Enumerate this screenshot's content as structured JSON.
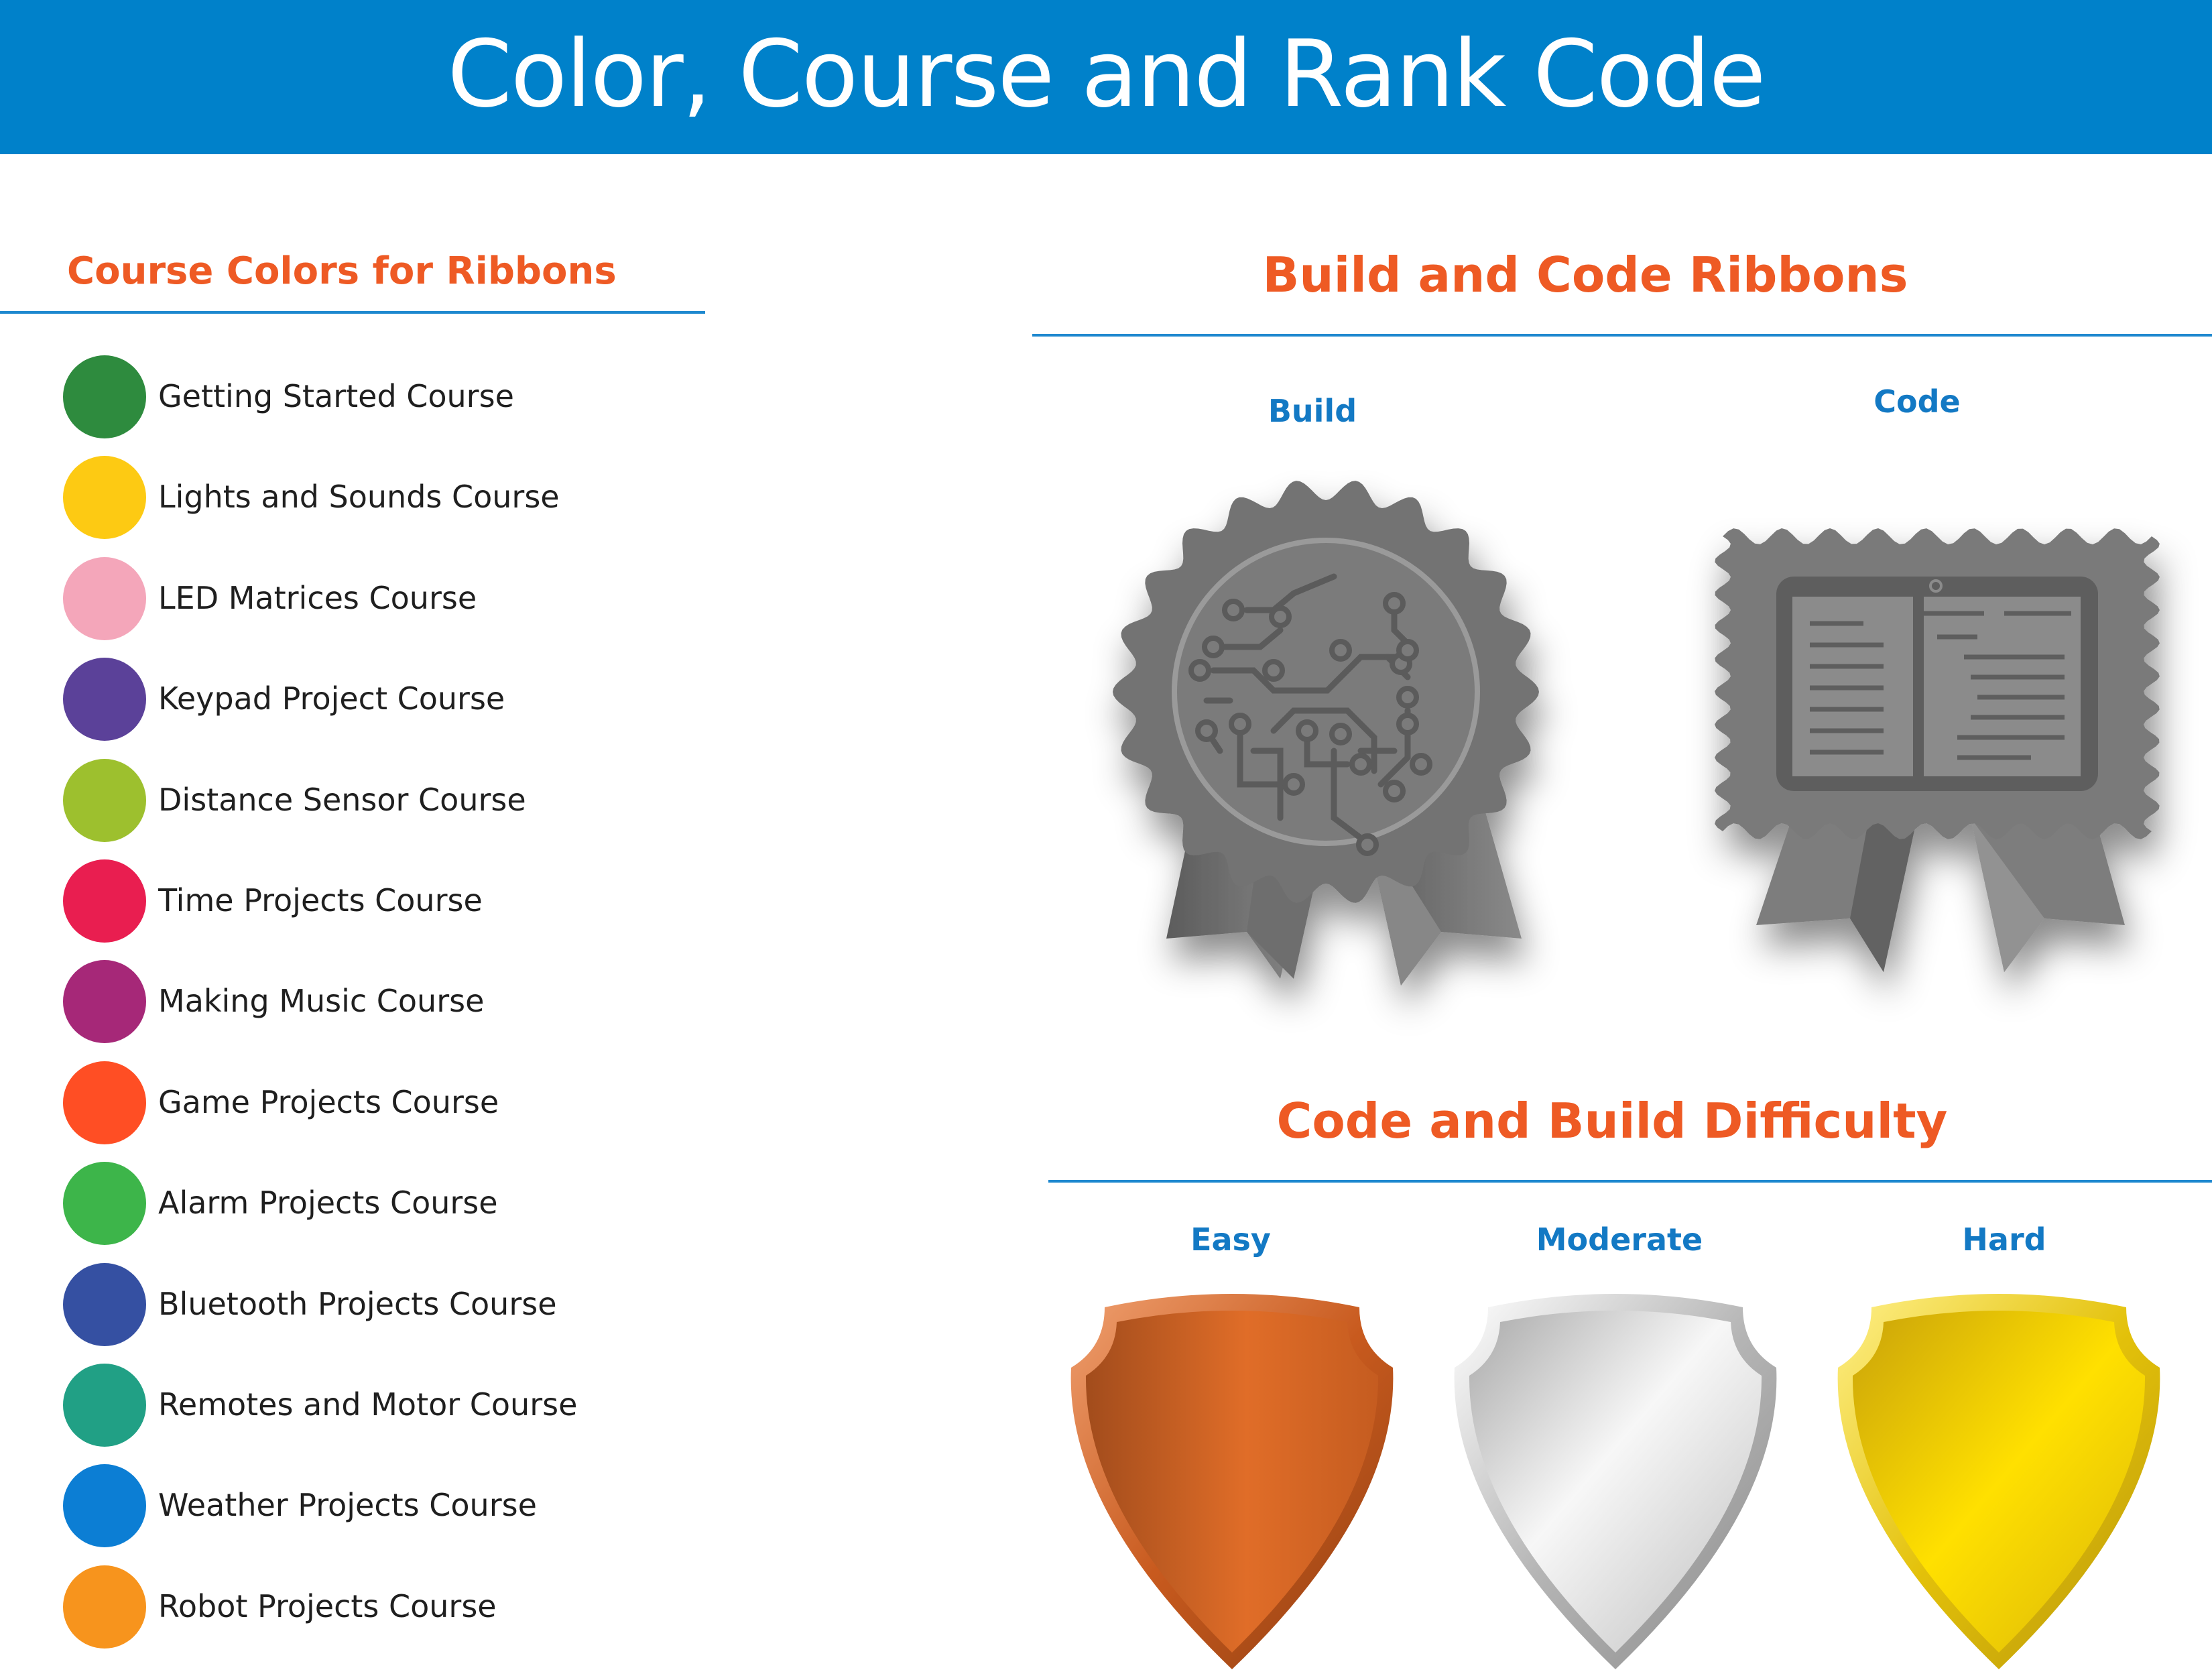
{
  "header": {
    "title": "Color, Course and Rank Code"
  },
  "course_colors": {
    "title": "Course Colors for Ribbons",
    "items": [
      {
        "label": "Getting Started Course",
        "color": "#2E8B3E"
      },
      {
        "label": "Lights and Sounds Course",
        "color": "#FDCA13"
      },
      {
        "label": "LED Matrices Course",
        "color": "#F4A6BA"
      },
      {
        "label": "Keypad Project Course",
        "color": "#5B4199"
      },
      {
        "label": "Distance Sensor Course",
        "color": "#9DC02E"
      },
      {
        "label": "Time Projects Course",
        "color": "#E91E50"
      },
      {
        "label": "Making Music Course",
        "color": "#A62878"
      },
      {
        "label": "Game Projects Course",
        "color": "#FF4E24"
      },
      {
        "label": "Alarm Projects Course",
        "color": "#3DB54A"
      },
      {
        "label": "Bluetooth Projects Course",
        "color": "#3550A2"
      },
      {
        "label": "Remotes and Motor Course",
        "color": "#21A085"
      },
      {
        "label": "Weather Projects Course",
        "color": "#0C7ED4"
      },
      {
        "label": "Robot Projects Course",
        "color": "#F7941D"
      }
    ]
  },
  "ribbons": {
    "title": "Build and Code Ribbons",
    "build_label": "Build",
    "code_label": "Code",
    "build_icon": "circuit-rosette-icon",
    "code_icon": "tablet-rosette-icon"
  },
  "difficulty": {
    "title": "Code and Build Difficulty",
    "levels": [
      {
        "label": "Easy",
        "icon": "bronze-shield-icon",
        "color": "#D8672A"
      },
      {
        "label": "Moderate",
        "icon": "silver-shield-icon",
        "color": "#C8C8C8"
      },
      {
        "label": "Hard",
        "icon": "gold-shield-icon",
        "color": "#F2D00C"
      }
    ]
  }
}
